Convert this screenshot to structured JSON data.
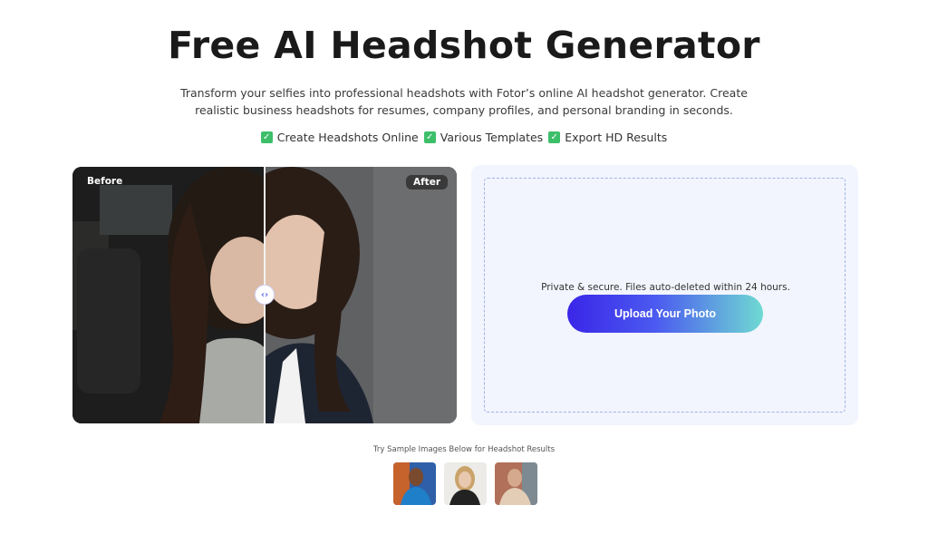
{
  "hero": {
    "title": "Free AI Headshot Generator",
    "subtitle": "Transform your selfies into professional headshots with Fotor’s online AI headshot generator. Create realistic business headshots for resumes, company profiles, and personal branding in seconds.",
    "features": [
      {
        "icon": "check-icon",
        "label": "Create Headshots Online"
      },
      {
        "icon": "check-icon",
        "label": "Various Templates"
      },
      {
        "icon": "check-icon",
        "label": "Export HD Results"
      }
    ]
  },
  "compare": {
    "before_label": "Before",
    "after_label": "After",
    "handle_icon": "compare-handle-icon"
  },
  "upload": {
    "privacy_text": "Private & secure. Files auto-deleted within 24 hours.",
    "button_label": "Upload Your Photo"
  },
  "samples": {
    "label": "Try Sample Images Below for Headshot Results",
    "images": [
      {
        "name": "sample-man-blue-suit"
      },
      {
        "name": "sample-woman-blonde"
      },
      {
        "name": "sample-man-beige"
      }
    ]
  },
  "colors": {
    "check": "#3dbf6a",
    "panel_bg": "#f2f5fd",
    "button_start": "#3a26e8",
    "button_end": "#6fdad2"
  }
}
